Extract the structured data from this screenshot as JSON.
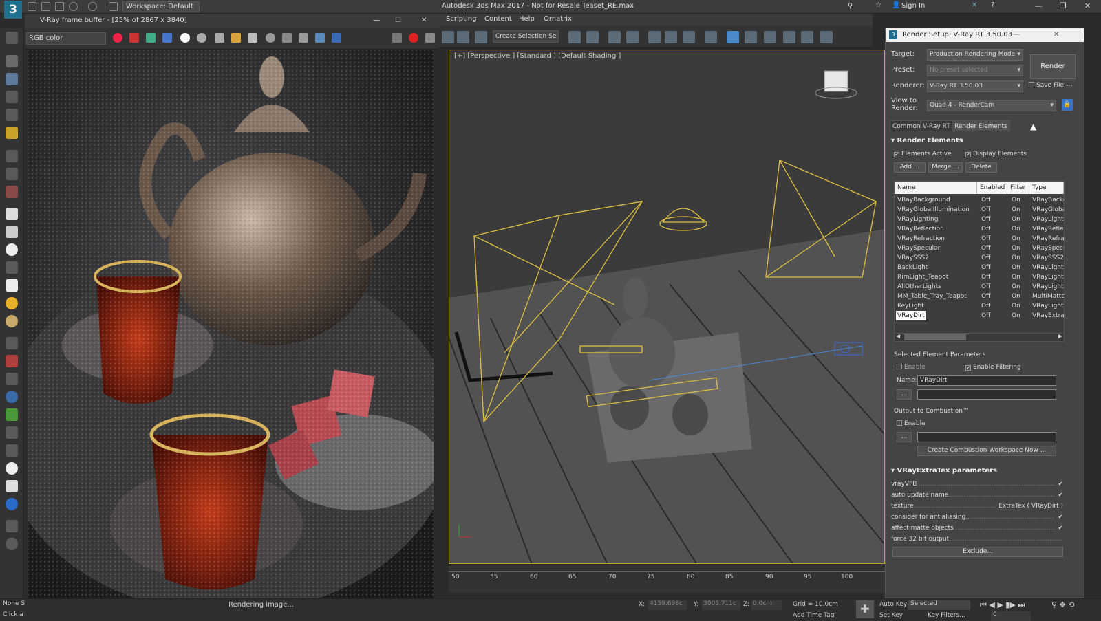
{
  "app": {
    "logo": "3",
    "workspace": "Workspace: Default",
    "title": "Autodesk 3ds Max 2017 - Not for Resale    Teaset_RE.max",
    "sign_in": "Sign In"
  },
  "vfb": {
    "title": "V-Ray frame buffer - [25% of 2867 x 3840]",
    "channel": "RGB color",
    "status": "Rendering image..."
  },
  "menu": [
    "Scripting",
    "Content",
    "Help",
    "Ornatrix"
  ],
  "toolbar": {
    "selection_set": "Create Selection Se"
  },
  "viewport": {
    "label": "[+] [Perspective ] [Standard ] [Default Shading ]",
    "timeline_ticks": [
      "50",
      "55",
      "60",
      "65",
      "70",
      "75",
      "80",
      "85",
      "90",
      "95",
      "100"
    ]
  },
  "status": {
    "none": "None S",
    "click": "Click a",
    "x_label": "X:",
    "x_value": "4159.698c",
    "y_label": "Y:",
    "y_value": "3005.711c",
    "z_label": "Z:",
    "z_value": "0.0cm",
    "grid": "Grid = 10.0cm",
    "add_time_tag": "Add Time Tag",
    "auto_key": "Auto Key",
    "set_key": "Set Key",
    "selected": "Selected",
    "key_filters": "Key Filters...",
    "frame": "0"
  },
  "render_setup": {
    "title": "Render Setup: V-Ray RT 3.50.03",
    "target_label": "Target:",
    "target": "Production Rendering Mode",
    "preset_label": "Preset:",
    "preset": "No preset selected",
    "renderer_label": "Renderer:",
    "renderer": "V-Ray RT 3.50.03",
    "save_file": "Save File",
    "view_label": "View to Render:",
    "view": "Quad 4 - RenderCam",
    "render_button": "Render",
    "tabs": [
      "Common",
      "V-Ray RT",
      "Render Elements"
    ],
    "elements_header": "Render Elements",
    "elements_active": "Elements Active",
    "display_elements": "Display Elements",
    "add": "Add ...",
    "merge": "Merge ...",
    "delete": "Delete",
    "columns": [
      "Name",
      "Enabled",
      "Filter",
      "Type"
    ],
    "rows": [
      [
        "VRayBackground",
        "Off",
        "On",
        "VRayBackgr"
      ],
      [
        "VRayGlobalIllumination",
        "Off",
        "On",
        "VRayGlobalI"
      ],
      [
        "VRayLighting",
        "Off",
        "On",
        "VRayLightin"
      ],
      [
        "VRayReflection",
        "Off",
        "On",
        "VRayReflec"
      ],
      [
        "VRayRefraction",
        "Off",
        "On",
        "VRayRefrac"
      ],
      [
        "VRaySpecular",
        "Off",
        "On",
        "VRaySpecul"
      ],
      [
        "VRaySSS2",
        "Off",
        "On",
        "VRaySSS2"
      ],
      [
        "BackLight",
        "Off",
        "On",
        "VRayLightS"
      ],
      [
        "RimLight_Teapot",
        "Off",
        "On",
        "VRayLightS"
      ],
      [
        "AllOtherLights",
        "Off",
        "On",
        "VRayLightS"
      ],
      [
        "MM_Table_Tray_Teapot",
        "Off",
        "On",
        "MultiMatteE"
      ],
      [
        "KeyLight",
        "Off",
        "On",
        "VRayLightS"
      ],
      [
        "VRayDirt",
        "Off",
        "On",
        "VRayExtraT"
      ]
    ],
    "selected_params": "Selected Element Parameters",
    "enable": "Enable",
    "enable_filtering": "Enable Filtering",
    "name_label": "Name:",
    "name_value": "VRayDirt",
    "dots": "...",
    "combustion": "Output to Combustion™",
    "combustion_enable": "Enable",
    "create_combustion": "Create Combustion Workspace Now ...",
    "extratex_header": "VRayExtraTex parameters",
    "params": [
      {
        "label": "vrayVFB",
        "value": "✔"
      },
      {
        "label": "auto update name",
        "value": "✔"
      },
      {
        "label": "texture",
        "value": "ExtraTex ( VRayDirt )"
      },
      {
        "label": "consider for antialiasing",
        "value": "✔"
      },
      {
        "label": "affect matte objects",
        "value": "✔"
      },
      {
        "label": "force 32 bit output",
        "value": ""
      }
    ],
    "exclude": "Exclude..."
  }
}
